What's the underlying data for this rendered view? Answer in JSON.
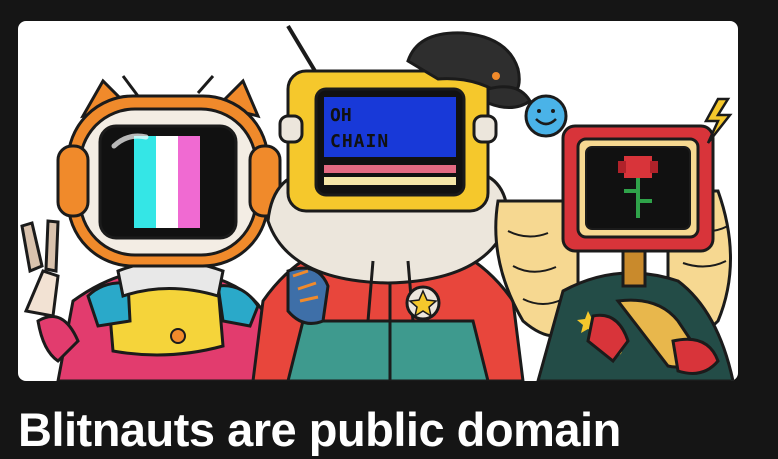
{
  "article": {
    "title": "Blitnauts are public domain",
    "hero_alt": "Three Blitnaut characters with TV-screen heads"
  },
  "hero": {
    "screen_text_line1": "OH",
    "screen_text_line2": "CHAIN"
  },
  "colors": {
    "background": "#151515",
    "title": "#ffffff",
    "card": "#ffffff"
  }
}
